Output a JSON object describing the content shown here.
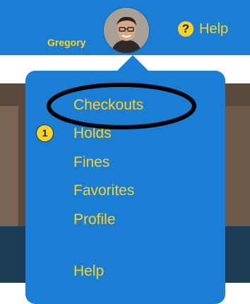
{
  "header": {
    "username": "Gregory",
    "help_label": "Help",
    "help_icon": "question-circle-icon"
  },
  "menu": {
    "items": [
      {
        "label": "Checkouts"
      },
      {
        "label": "Holds",
        "badge": "1"
      },
      {
        "label": "Fines"
      },
      {
        "label": "Favorites"
      },
      {
        "label": "Profile"
      },
      {
        "label": "Help"
      }
    ]
  },
  "colors": {
    "header_bg": "#1a7fd4",
    "accent_text": "#ffd21f",
    "annotation_outline": "#000000"
  }
}
